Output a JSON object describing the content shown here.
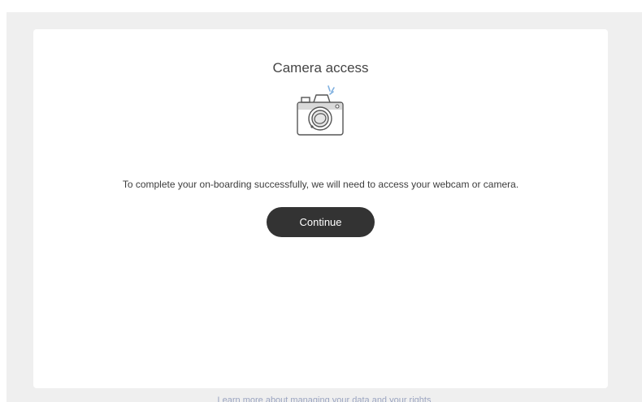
{
  "dialog": {
    "title": "Camera access",
    "message": "To complete your on-boarding successfully, we will need to access your webcam or camera.",
    "continue_label": "Continue",
    "icon": "camera-icon"
  },
  "footer": {
    "link_text": "Learn more about managing your data and your rights"
  },
  "colors": {
    "background": "#efefef",
    "card": "#ffffff",
    "button": "#333333",
    "link": "#9aa4c0"
  }
}
